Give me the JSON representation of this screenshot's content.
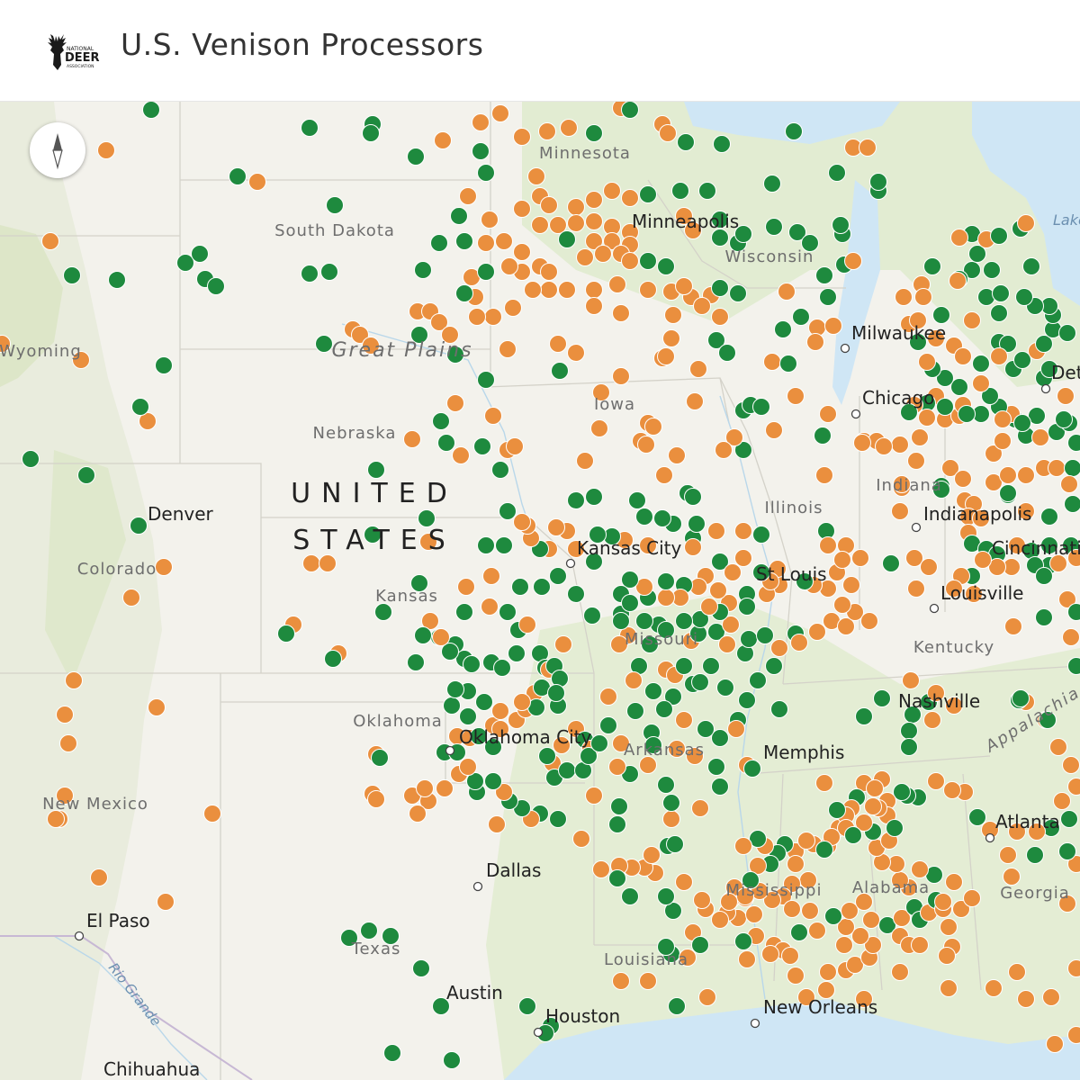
{
  "header": {
    "title": "U.S. Venison Processors",
    "logo": {
      "line1": "NATIONAL",
      "line2": "DEER",
      "line3": "ASSOCIATION"
    }
  },
  "map": {
    "country_label_line1": "UNITED",
    "country_label_line2": "STATES",
    "region_label": "Great Plains",
    "states": [
      {
        "name": "South Dakota"
      },
      {
        "name": "Wyoming"
      },
      {
        "name": "Nebraska"
      },
      {
        "name": "Iowa"
      },
      {
        "name": "Colorado"
      },
      {
        "name": "Kansas"
      },
      {
        "name": "Illinois"
      },
      {
        "name": "Indiana"
      },
      {
        "name": "Missouri"
      },
      {
        "name": "Kentucky"
      },
      {
        "name": "Oklahoma"
      },
      {
        "name": "Arkansas"
      },
      {
        "name": "New Mexico"
      },
      {
        "name": "Texas"
      },
      {
        "name": "Louisiana"
      },
      {
        "name": "Mississippi"
      },
      {
        "name": "Alabama"
      },
      {
        "name": "Georgia"
      },
      {
        "name": "Minnesota"
      },
      {
        "name": "Wisconsin"
      }
    ],
    "cities": [
      {
        "name": "Minneapolis"
      },
      {
        "name": "Milwaukee"
      },
      {
        "name": "Chicago"
      },
      {
        "name": "Detroit"
      },
      {
        "name": "Denver"
      },
      {
        "name": "Kansas City"
      },
      {
        "name": "St Louis"
      },
      {
        "name": "Indianapolis"
      },
      {
        "name": "Cincinnati"
      },
      {
        "name": "Louisville"
      },
      {
        "name": "Nashville"
      },
      {
        "name": "Memphis"
      },
      {
        "name": "Oklahoma City"
      },
      {
        "name": "Dallas"
      },
      {
        "name": "Atlanta"
      },
      {
        "name": "El Paso"
      },
      {
        "name": "Austin"
      },
      {
        "name": "Houston"
      },
      {
        "name": "New Orleans"
      },
      {
        "name": "Chihuahua"
      }
    ],
    "features": [
      {
        "name": "Rio Grande"
      },
      {
        "name": "Appalachia"
      },
      {
        "name": "Lake Huron"
      }
    ],
    "colors": {
      "green_marker": "#1e8a3e",
      "orange_marker": "#ea8f3e",
      "water": "#cfe6f5",
      "land": "#f2f1ea",
      "forest": "#dfe9cf"
    }
  },
  "controls": {
    "compass_icon": "compass-icon"
  }
}
